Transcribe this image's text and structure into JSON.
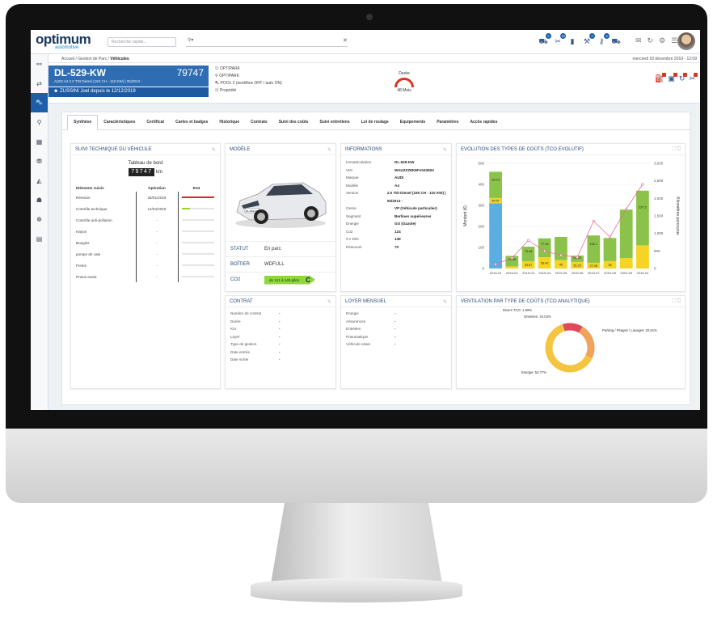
{
  "topbar": {
    "logo": "optimum",
    "logo_sub": "automotive",
    "search_placeholder": "Recherche rapide...",
    "location_value": "",
    "badges": [
      "2",
      "15",
      "",
      "2",
      "5",
      ""
    ]
  },
  "breadcrumb": {
    "items": [
      "Accueil",
      "Gestion de Parc",
      "Véhicules"
    ],
    "date": "mercredi 18 décembre 2019 - 12:09"
  },
  "vehicle": {
    "plate": "DL-529-KW",
    "km": "79747",
    "model": "AUDI A4 2.0 TDI Diesel (150 CH - 110 KW) | 05/2013 -",
    "driver": "ZUSSINI Joel depuis le 12/12/2019",
    "info": [
      "OPTIPARK",
      "OPTIPARK",
      "POOL 2 (workflow OFF / auto ON)",
      "Propriété"
    ],
    "duree_label": "Durée",
    "duree_value": "48 Mois"
  },
  "tabs": [
    "Synthèse",
    "Caractéristiques",
    "Certificat",
    "Cartes et badges",
    "Historique",
    "Contrats",
    "Suivi des coûts",
    "Suivi entretiens",
    "Loi de roulage",
    "Equipements",
    "Paramètres",
    "Accès rapides"
  ],
  "suivi": {
    "title": "SUIVI TECHNIQUE DU VÉHICULE",
    "tableau_label": "Tableau de bord",
    "odometer": "79747",
    "km_unit": "km",
    "headers": [
      "Eléments suivis",
      "Opération",
      "Etat"
    ],
    "rows": [
      {
        "item": "Révision",
        "date": "26/01/2019",
        "bar_fill": 1.0,
        "color": "#d8262c"
      },
      {
        "item": "Contrôle technique",
        "date": "12/04/2019",
        "bar_fill": 0.25,
        "color": "#9ad12c"
      },
      {
        "item": "Contrôle anti-pollution",
        "date": "-",
        "bar_fill": 0,
        "color": "#ccc"
      },
      {
        "item": "Hayon",
        "date": "-",
        "bar_fill": 0,
        "color": "#ccc"
      },
      {
        "item": "Bougies",
        "date": "-",
        "bar_fill": 0,
        "color": "#ccc"
      },
      {
        "item": "pompe de cale",
        "date": "-",
        "bar_fill": 0,
        "color": "#ccc"
      },
      {
        "item": "Freins",
        "date": "-",
        "bar_fill": 0,
        "color": "#ccc"
      },
      {
        "item": "Pneus avant",
        "date": "-",
        "bar_fill": 0,
        "color": "#ccc"
      }
    ]
  },
  "modele": {
    "title": "MODÈLE",
    "car_plate": "DL-529-KW",
    "statut_label": "STATUT",
    "statut_value": "En parc",
    "boitier_label": "BOÎTIER",
    "boitier_value": "WDFULL",
    "co2_label": "CO2",
    "co2_value": "de 121 à 140 g/km",
    "co2_class": "C"
  },
  "informations": {
    "title": "INFORMATIONS",
    "rows": [
      {
        "k": "Immatriculation",
        "v": "DL-529-KW"
      },
      {
        "k": "VIN",
        "v": "WAUZZZ8K9FA043503"
      },
      {
        "k": "Marque",
        "v": "AUDI"
      },
      {
        "k": "Modèle",
        "v": "A4"
      },
      {
        "k": "Version",
        "v": "2.0 TDI Diesel (150 CH - 110 KW) | 05/2013 -"
      },
      {
        "k": "Genre",
        "v": "VP (Véhicule particulier)"
      },
      {
        "k": "Segment",
        "v": "Berlines supérieures"
      },
      {
        "k": "Energie",
        "v": "GO (Gazole)"
      },
      {
        "k": "Co2",
        "v": "124"
      },
      {
        "k": "CV DIN",
        "v": "149"
      },
      {
        "k": "Réservoir",
        "v": "70"
      }
    ]
  },
  "contrat": {
    "title": "CONTRAT",
    "rows": [
      {
        "k": "Numéro de contrat",
        "v": "-"
      },
      {
        "k": "Durée",
        "v": "-"
      },
      {
        "k": "Km",
        "v": "-"
      },
      {
        "k": "Loyer",
        "v": "-"
      },
      {
        "k": "Type de gestion",
        "v": "-"
      },
      {
        "k": "Date entrée",
        "v": "-"
      },
      {
        "k": "Date sortie",
        "v": "-"
      }
    ]
  },
  "loyer": {
    "title": "LOYER MENSUEL",
    "rows": [
      {
        "k": "Energie",
        "v": "-"
      },
      {
        "k": "Assurances",
        "v": "-"
      },
      {
        "k": "Entretien",
        "v": "-"
      },
      {
        "k": "Pneumatique",
        "v": "-"
      },
      {
        "k": "Véhicule relais",
        "v": "-"
      }
    ]
  },
  "colors": {
    "primary": "#2e6db4",
    "blue_bar": "#5aaee2",
    "green_bar": "#8bc34a",
    "yellow_bar": "#f5d423",
    "line": "#e56aa0"
  },
  "chart_data": [
    {
      "type": "bar",
      "title": "EVOLUTION DES TYPES DE COÛTS (TCO EVOLUTIF)",
      "ylabel": "Montant (€)",
      "y2label": "Kilomètres parcourus",
      "ylim": [
        0,
        500
      ],
      "y2lim": [
        0,
        3000
      ],
      "yticks": [
        0,
        100,
        200,
        300,
        400,
        500
      ],
      "y2ticks": [
        "0",
        "500",
        "1,000",
        "1,500",
        "2,000",
        "2,500",
        "3,000"
      ],
      "categories": [
        "2019-01",
        "2019-02",
        "2019-03",
        "2019-04",
        "2019-05",
        "2019-06",
        "2019-07",
        "2019-08",
        "2019-09",
        "2019-10"
      ],
      "series": [
        {
          "values": [
            310,
            0,
            0,
            0,
            0,
            0,
            0,
            0,
            0,
            0
          ]
        },
        {
          "values": [
            25,
            10,
            33.67,
            53.42,
            40,
            31.22,
            27.08,
            35,
            50,
            110
          ]
        },
        {
          "values": [
            125,
            50,
            70,
            90,
            110,
            30,
            130,
            110,
            230,
            260
          ]
        }
      ],
      "line_values": [
        120,
        300,
        800,
        500,
        380,
        320,
        1350,
        900,
        1700,
        2400
      ],
      "bar_labels": [
        "84.97",
        "",
        "33.67",
        "53.42",
        "40",
        "31.22",
        "27.08",
        "35",
        "",
        ""
      ],
      "extra_labels": [
        "68.23",
        "25.48",
        "75.18",
        "77.08",
        "",
        "65.49",
        "152.1",
        "",
        "",
        "237.3"
      ]
    },
    {
      "type": "pie",
      "title": "VENTILATION PAR TYPE DE COÛTS (TCO ANALYTIQUE)",
      "labels": [
        "Divers TCO: 1.59%",
        "Entretien: 10.03%",
        "Parking / Péages / Lavages: 20.61%",
        "Energie: 54.77%"
      ],
      "values": [
        1.59,
        10.03,
        20.61,
        54.77
      ],
      "colors": [
        "#d84a4a",
        "#e0475a",
        "#f0a35a",
        "#f5c542"
      ]
    }
  ]
}
